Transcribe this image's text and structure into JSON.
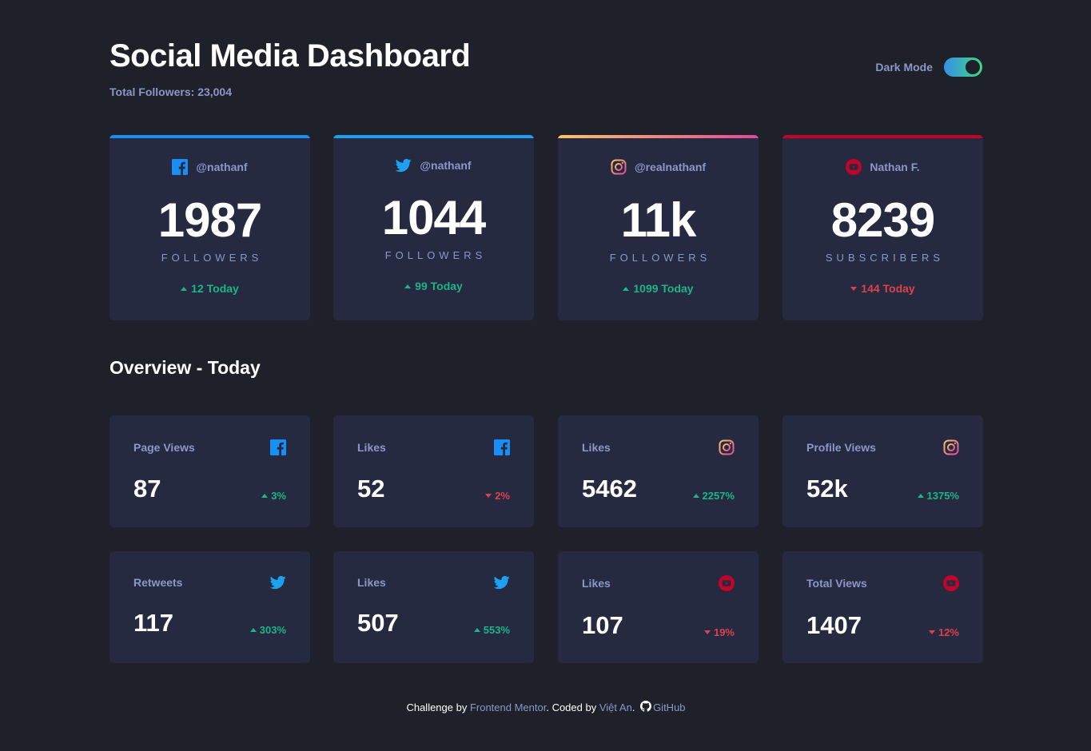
{
  "header": {
    "title": "Social Media Dashboard",
    "subtitle": "Total Followers: 23,004",
    "dark_mode_label": "Dark Mode",
    "dark_mode_on": true
  },
  "colors": {
    "background": "#1e202a",
    "card": "#252a41",
    "muted_text": "#8b97c6",
    "up": "#1db489",
    "down": "#dc414c",
    "facebook": "#198ff5",
    "twitter": "#1ca0f2",
    "youtube": "#c4032a",
    "instagram_gradient": [
      "#fdc468",
      "#df4996"
    ]
  },
  "followers": [
    {
      "platform": "facebook",
      "icon": "facebook-icon",
      "handle": "@nathanf",
      "count": "1987",
      "unit": "FOLLOWERS",
      "delta": "12 Today",
      "trend": "up"
    },
    {
      "platform": "twitter",
      "icon": "twitter-icon",
      "handle": "@nathanf",
      "count": "1044",
      "unit": "FOLLOWERS",
      "delta": "99 Today",
      "trend": "up"
    },
    {
      "platform": "instagram",
      "icon": "instagram-icon",
      "handle": "@realnathanf",
      "count": "11k",
      "unit": "FOLLOWERS",
      "delta": "1099 Today",
      "trend": "up"
    },
    {
      "platform": "youtube",
      "icon": "youtube-icon",
      "handle": "Nathan F.",
      "count": "8239",
      "unit": "SUBSCRIBERS",
      "delta": "144 Today",
      "trend": "down"
    }
  ],
  "overview": {
    "heading": "Overview - Today",
    "items": [
      {
        "label": "Page Views",
        "icon": "facebook-icon",
        "value": "87",
        "change": "3%",
        "trend": "up"
      },
      {
        "label": "Likes",
        "icon": "facebook-icon",
        "value": "52",
        "change": "2%",
        "trend": "down"
      },
      {
        "label": "Likes",
        "icon": "instagram-icon",
        "value": "5462",
        "change": "2257%",
        "trend": "up"
      },
      {
        "label": "Profile Views",
        "icon": "instagram-icon",
        "value": "52k",
        "change": "1375%",
        "trend": "up"
      },
      {
        "label": "Retweets",
        "icon": "twitter-icon",
        "value": "117",
        "change": "303%",
        "trend": "up"
      },
      {
        "label": "Likes",
        "icon": "twitter-icon",
        "value": "507",
        "change": "553%",
        "trend": "up"
      },
      {
        "label": "Likes",
        "icon": "youtube-icon",
        "value": "107",
        "change": "19%",
        "trend": "down"
      },
      {
        "label": "Total Views",
        "icon": "youtube-icon",
        "value": "1407",
        "change": "12%",
        "trend": "down"
      }
    ]
  },
  "footer": {
    "prefix": "Challenge by ",
    "mentor": "Frontend Mentor",
    "middle": ". Coded by ",
    "author": "Việt An",
    "after_author": ".",
    "github": "GitHub"
  }
}
